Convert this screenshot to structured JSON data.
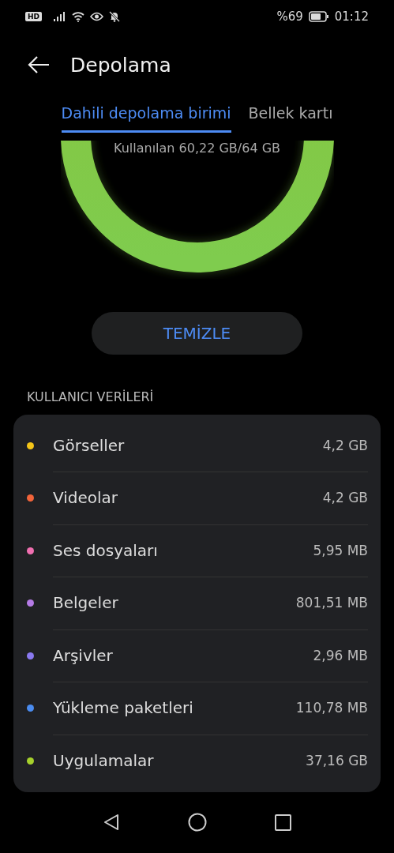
{
  "status_bar": {
    "network_badge": "HD",
    "battery_text": "%69",
    "time": "01:12"
  },
  "header": {
    "title": "Depolama"
  },
  "tabs": [
    {
      "label": "Dahili depolama birimi",
      "selected": true
    },
    {
      "label": "Bellek kartı",
      "selected": false
    }
  ],
  "usage": {
    "text": "Kullanılan 60,22 GB/64 GB"
  },
  "clean_button": "TEMİZLE",
  "section_title": "KULLANICI VERİLERİ",
  "items": [
    {
      "name": "Görseller",
      "size": "4,2 GB",
      "color": "#f5c518"
    },
    {
      "name": "Videolar",
      "size": "4,2 GB",
      "color": "#f2643a"
    },
    {
      "name": "Ses dosyaları",
      "size": "5,95 MB",
      "color": "#f06fb0"
    },
    {
      "name": "Belgeler",
      "size": "801,51 MB",
      "color": "#b57be6"
    },
    {
      "name": "Arşivler",
      "size": "2,96 MB",
      "color": "#8a79f0"
    },
    {
      "name": "Yükleme paketleri",
      "size": "110,78 MB",
      "color": "#4a8cf0"
    },
    {
      "name": "Uygulamalar",
      "size": "37,16 GB",
      "color": "#a6d12c"
    }
  ]
}
